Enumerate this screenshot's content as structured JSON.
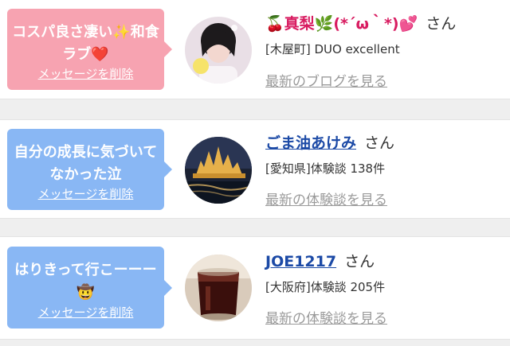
{
  "messages": [
    {
      "bubble_text": "コスパ良さ凄い✨和食ラブ❤️",
      "delete_label": "メッセージを削除",
      "name_prefix": "🍒",
      "name": "真梨🌿(*´ω｀*)💕",
      "honorific": "さん",
      "subtitle": "[木屋町] DUO excellent",
      "more_link": "最新のブログを見る",
      "bubble_color": "#f7a3b1"
    },
    {
      "bubble_text": "自分の成長に気づいてなかった泣",
      "delete_label": "メッセージを削除",
      "name": "ごま油あけみ",
      "honorific": "さん",
      "subtitle": "[愛知県]体験談 138件",
      "more_link": "最新の体験談を見る",
      "bubble_color": "#89b7f4"
    },
    {
      "bubble_text": "はりきって行こーーー🤠",
      "delete_label": "メッセージを削除",
      "name": "JOE1217",
      "honorific": "さん",
      "subtitle": "[大阪府]体験談 205件",
      "more_link": "最新の体験談を見る",
      "bubble_color": "#89b7f4"
    }
  ],
  "colors": {
    "link_blue": "#1c4aa6",
    "muted_link": "#9a9a9a",
    "background": "#efefef"
  }
}
